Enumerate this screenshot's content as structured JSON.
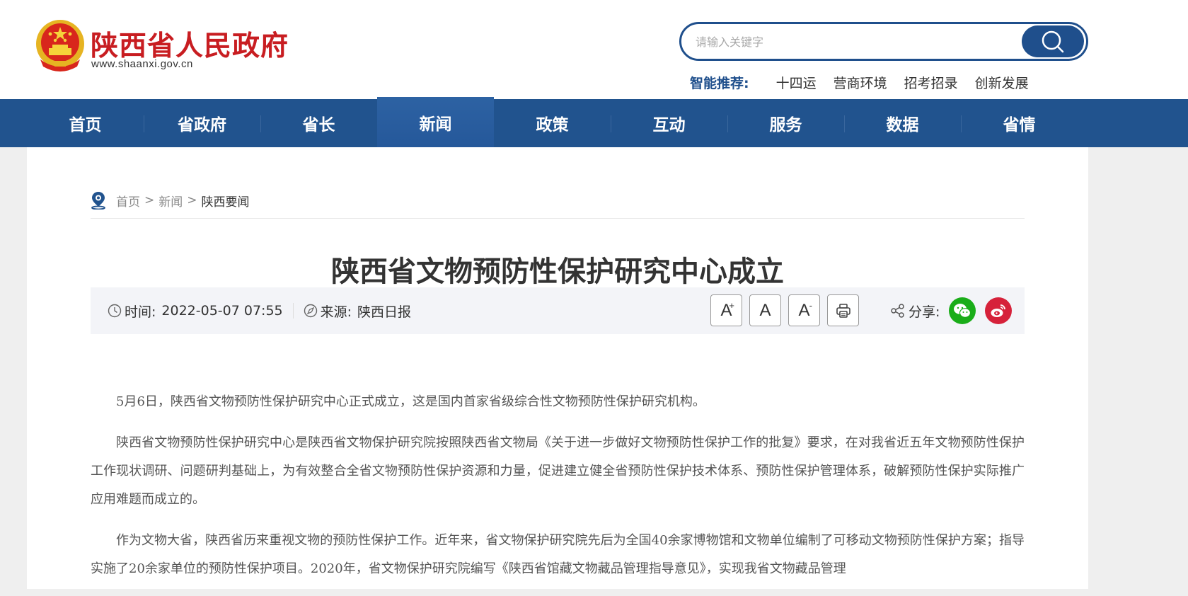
{
  "header": {
    "site_title": "陕西省人民政府",
    "site_url": "www.shaanxi.gov.cn",
    "search": {
      "placeholder": "请输入关键字",
      "value": ""
    },
    "recommend_label": "智能推荐:",
    "recommend_links": [
      "十四运",
      "营商环境",
      "招考招录",
      "创新发展"
    ]
  },
  "nav": {
    "items": [
      "首页",
      "省政府",
      "省长",
      "新闻",
      "政策",
      "互动",
      "服务",
      "数据",
      "省情"
    ],
    "active": "新闻"
  },
  "breadcrumb": {
    "items": [
      "首页",
      "新闻"
    ],
    "separator": ">",
    "current": "陕西要闻"
  },
  "article": {
    "title": "陕西省文物预防性保护研究中心成立",
    "time_label": "时间:",
    "time_value": "2022-05-07 07:55",
    "source_label": "来源:",
    "source_value": "陕西日报",
    "tools": {
      "font_larger": "A",
      "font_normal": "A",
      "font_smaller": "A",
      "larger_sup": "+",
      "smaller_sup": "-"
    },
    "share_label": "分享:",
    "paragraphs": [
      "5月6日，陕西省文物预防性保护研究中心正式成立，这是国内首家省级综合性文物预防性保护研究机构。",
      "陕西省文物预防性保护研究中心是陕西省文物保护研究院按照陕西省文物局《关于进一步做好文物预防性保护工作的批复》要求，在对我省近五年文物预防性保护工作现状调研、问题研判基础上，为有效整合全省文物预防性保护资源和力量，促进建立健全省预防性保护技术体系、预防性保护管理体系，破解预防性保护实际推广应用难题而成立的。",
      "作为文物大省，陕西省历来重视文物的预防性保护工作。近年来，省文物保护研究院先后为全国40余家博物馆和文物单位编制了可移动文物预防性保护方案；指导实施了20余家单位的预防性保护项目。2020年，省文物保护研究院编写《陕西省馆藏文物藏品管理指导意见》，实现我省文物藏品管理"
    ]
  },
  "colors": {
    "brand_blue": "#21538e",
    "brand_red": "#c81d21",
    "wechat_green": "#1aad19",
    "weibo_red": "#d6213a"
  }
}
